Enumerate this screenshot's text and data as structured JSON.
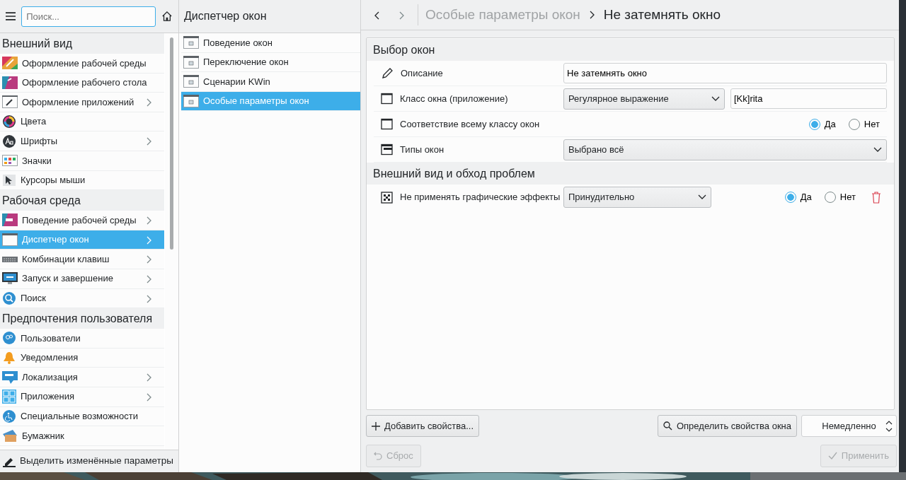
{
  "sidebar": {
    "search": {
      "placeholder": "Поиск..."
    },
    "groups": [
      {
        "title": "Внешний вид",
        "items": [
          {
            "label": "Оформление рабочей среды",
            "has_children": false,
            "selected": false
          },
          {
            "label": "Оформление рабочего стола",
            "has_children": false,
            "selected": false
          },
          {
            "label": "Оформление приложений",
            "has_children": true,
            "selected": false
          },
          {
            "label": "Цвета",
            "has_children": false,
            "selected": false
          },
          {
            "label": "Шрифты",
            "has_children": true,
            "selected": false
          },
          {
            "label": "Значки",
            "has_children": false,
            "selected": false
          },
          {
            "label": "Курсоры мыши",
            "has_children": false,
            "selected": false
          }
        ]
      },
      {
        "title": "Рабочая среда",
        "items": [
          {
            "label": "Поведение рабочей среды",
            "has_children": true,
            "selected": false
          },
          {
            "label": "Диспетчер окон",
            "has_children": true,
            "selected": true
          },
          {
            "label": "Комбинации клавиш",
            "has_children": true,
            "selected": false
          },
          {
            "label": "Запуск и завершение",
            "has_children": true,
            "selected": false
          },
          {
            "label": "Поиск",
            "has_children": true,
            "selected": false
          }
        ]
      },
      {
        "title": "Предпочтения пользователя",
        "items": [
          {
            "label": "Пользователи",
            "has_children": false,
            "selected": false
          },
          {
            "label": "Уведомления",
            "has_children": false,
            "selected": false
          },
          {
            "label": "Локализация",
            "has_children": true,
            "selected": false
          },
          {
            "label": "Приложения",
            "has_children": true,
            "selected": false
          },
          {
            "label": "Специальные возможности",
            "has_children": false,
            "selected": false
          },
          {
            "label": "Бумажник",
            "has_children": false,
            "selected": false
          }
        ]
      }
    ],
    "footer": {
      "label": "Выделить изменённые параметры"
    }
  },
  "subpanel": {
    "title": "Диспетчер окон",
    "items": [
      {
        "label": "Поведение окон",
        "selected": false
      },
      {
        "label": "Переключение окон",
        "selected": false
      },
      {
        "label": "Сценарии KWin",
        "selected": false
      },
      {
        "label": "Особые параметры окон",
        "selected": true
      }
    ]
  },
  "breadcrumb": {
    "parent": "Особые параметры окон",
    "current": "Не затемнять окно"
  },
  "sections": [
    {
      "title": "Выбор окон",
      "rows": [
        {
          "kind": "text",
          "label": "Описание",
          "value": "Не затемнять окно"
        },
        {
          "kind": "combo_text",
          "label": "Класс окна (приложение)",
          "option": "Регулярное выражение",
          "value": "[Kk]rita"
        },
        {
          "kind": "radio",
          "label": "Соответствие всему классу окон",
          "options": [
            {
              "label": "Да",
              "selected": true
            },
            {
              "label": "Нет",
              "selected": false
            }
          ]
        },
        {
          "kind": "combo",
          "label": "Типы окон",
          "option": "Выбрано всё"
        }
      ]
    },
    {
      "title": "Внешний вид и обход проблем",
      "rows": [
        {
          "kind": "combo_radio",
          "label": "Не применять графические эффекты",
          "option": "Принудительно",
          "options": [
            {
              "label": "Да",
              "selected": true
            },
            {
              "label": "Нет",
              "selected": false
            }
          ],
          "removable": true
        }
      ]
    }
  ],
  "actions": {
    "add": "Добавить свойства...",
    "detect": "Определить свойства окна",
    "delay": "Немедленно"
  },
  "footer_buttons": [
    {
      "kind": "reset",
      "label": "Сброс",
      "disabled": true
    },
    {
      "kind": "apply",
      "label": "Применить",
      "disabled": true
    }
  ]
}
